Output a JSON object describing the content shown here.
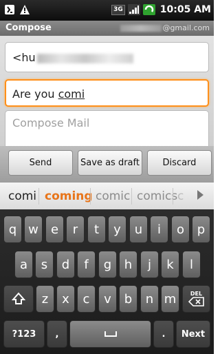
{
  "statusbar": {
    "left_icons": [
      "usb-debug-icon",
      "warning-icon"
    ],
    "right_icons": [
      "3g-network-icon",
      "signal-icon",
      "battery-charging-icon"
    ],
    "network_label": "3G",
    "time": "10:05 AM"
  },
  "titlebar": {
    "title": "Compose",
    "account": "@gmail.com"
  },
  "compose": {
    "to_prefix": "<hu",
    "subject_prefix": "Are you ",
    "subject_composing": "comi",
    "body_placeholder": "Compose Mail"
  },
  "buttons": {
    "send": "Send",
    "save_draft": "Save as draft",
    "discard": "Discard"
  },
  "suggestions": {
    "items": [
      "comi",
      "coming",
      "comic",
      "comics",
      "c"
    ],
    "highlighted": "coming",
    "more_icon": "arrow-right-icon"
  },
  "keyboard": {
    "row1": [
      "q",
      "w",
      "e",
      "r",
      "t",
      "y",
      "u",
      "i",
      "o",
      "p"
    ],
    "row2": [
      "a",
      "s",
      "d",
      "f",
      "g",
      "h",
      "j",
      "k",
      "l"
    ],
    "row3": [
      "z",
      "x",
      "c",
      "v",
      "b",
      "n",
      "m"
    ],
    "shift_icon": "shift-icon",
    "delete_label": "DEL",
    "symbols_label": "?123",
    "comma_label": ",",
    "period_label": ".",
    "next_label": "Next"
  },
  "colors": {
    "focus": "#ff8f1a",
    "suggestion_highlight": "#e8751a"
  }
}
